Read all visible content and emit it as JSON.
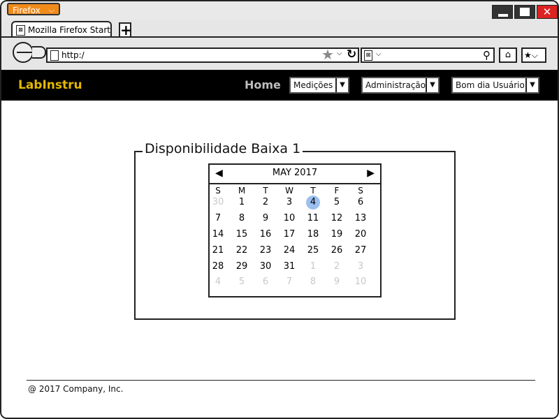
{
  "browser": {
    "menu_label": "Firefox",
    "tab_title": "Mozilla Firefox Start Page",
    "url": "http:/"
  },
  "app": {
    "brand": "LabInstru",
    "nav_home": "Home",
    "menu_medicoes": "Medições",
    "menu_admin": "Administração",
    "menu_user": "Bom dia Usuário"
  },
  "panel": {
    "title": "Disponibilidade Baixa 1"
  },
  "calendar": {
    "month_label": "MAY 2017",
    "weekdays": [
      "S",
      "M",
      "T",
      "W",
      "T",
      "F",
      "S"
    ],
    "selected_day": "4",
    "weeks": [
      [
        "30",
        "1",
        "2",
        "3",
        "4",
        "5",
        "6"
      ],
      [
        "7",
        "8",
        "9",
        "10",
        "11",
        "12",
        "13"
      ],
      [
        "14",
        "15",
        "16",
        "17",
        "18",
        "19",
        "20"
      ],
      [
        "21",
        "22",
        "23",
        "24",
        "25",
        "26",
        "27"
      ],
      [
        "28",
        "29",
        "30",
        "31",
        "1",
        "2",
        "3"
      ],
      [
        "4",
        "5",
        "6",
        "7",
        "8",
        "9",
        "10"
      ]
    ]
  },
  "footer": {
    "copyright": "@ 2017 Company, Inc."
  },
  "colors": {
    "brand": "#e5b800",
    "header_bg": "#000000",
    "selected_day": "#9cbff0",
    "firefox_button": "#f08a1b",
    "close_button": "#dd2222"
  }
}
